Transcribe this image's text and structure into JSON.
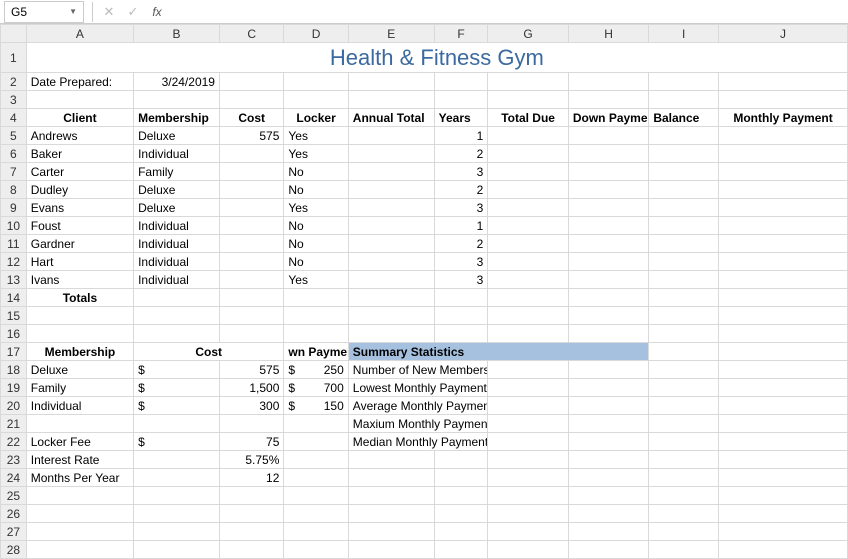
{
  "formula_bar": {
    "name_box": "G5",
    "cancel": "✕",
    "enter": "✓",
    "fx": "fx",
    "formula": ""
  },
  "columns": [
    "A",
    "B",
    "C",
    "D",
    "E",
    "F",
    "G",
    "H",
    "I",
    "J"
  ],
  "title": "Health & Fitness Gym",
  "date_prepared_label": "Date Prepared:",
  "date_prepared": "3/24/2019",
  "headers": {
    "client": "Client",
    "membership": "Membership",
    "cost": "Cost",
    "locker": "Locker",
    "annual_total": "Annual Total",
    "years": "Years",
    "total_due": "Total Due",
    "down_payment": "Down Payment",
    "balance": "Balance",
    "monthly_payment": "Monthly Payment"
  },
  "clients": [
    {
      "name": "Andrews",
      "membership": "Deluxe",
      "cost": "575",
      "locker": "Yes",
      "years": "1"
    },
    {
      "name": "Baker",
      "membership": "Individual",
      "cost": "",
      "locker": "Yes",
      "years": "2"
    },
    {
      "name": "Carter",
      "membership": "Family",
      "cost": "",
      "locker": "No",
      "years": "3"
    },
    {
      "name": "Dudley",
      "membership": "Deluxe",
      "cost": "",
      "locker": "No",
      "years": "2"
    },
    {
      "name": "Evans",
      "membership": "Deluxe",
      "cost": "",
      "locker": "Yes",
      "years": "3"
    },
    {
      "name": "Foust",
      "membership": "Individual",
      "cost": "",
      "locker": "No",
      "years": "1"
    },
    {
      "name": "Gardner",
      "membership": "Individual",
      "cost": "",
      "locker": "No",
      "years": "2"
    },
    {
      "name": "Hart",
      "membership": "Individual",
      "cost": "",
      "locker": "No",
      "years": "3"
    },
    {
      "name": "Ivans",
      "membership": "Individual",
      "cost": "",
      "locker": "Yes",
      "years": "3"
    }
  ],
  "totals_label": "Totals",
  "block2_headers": {
    "membership": "Membership",
    "cost": "Cost",
    "down_payment": "wn Payment"
  },
  "membership_table": [
    {
      "type": "Deluxe",
      "cost": "575",
      "down": "250"
    },
    {
      "type": "Family",
      "cost": "1,500",
      "down": "700"
    },
    {
      "type": "Individual",
      "cost": "300",
      "down": "150"
    }
  ],
  "locker_fee_label": "Locker Fee",
  "locker_fee": "75",
  "interest_rate_label": "Interest Rate",
  "interest_rate": "5.75%",
  "months_per_year_label": "Months Per Year",
  "months_per_year": "12",
  "summary_header": "Summary Statistics",
  "summary": [
    "Number of New Members",
    "Lowest Monthly Payment",
    "Average Monthly Payment",
    "Maxium Monthly Payment",
    "Median Monthly Payment"
  ],
  "currency_symbol": "$"
}
